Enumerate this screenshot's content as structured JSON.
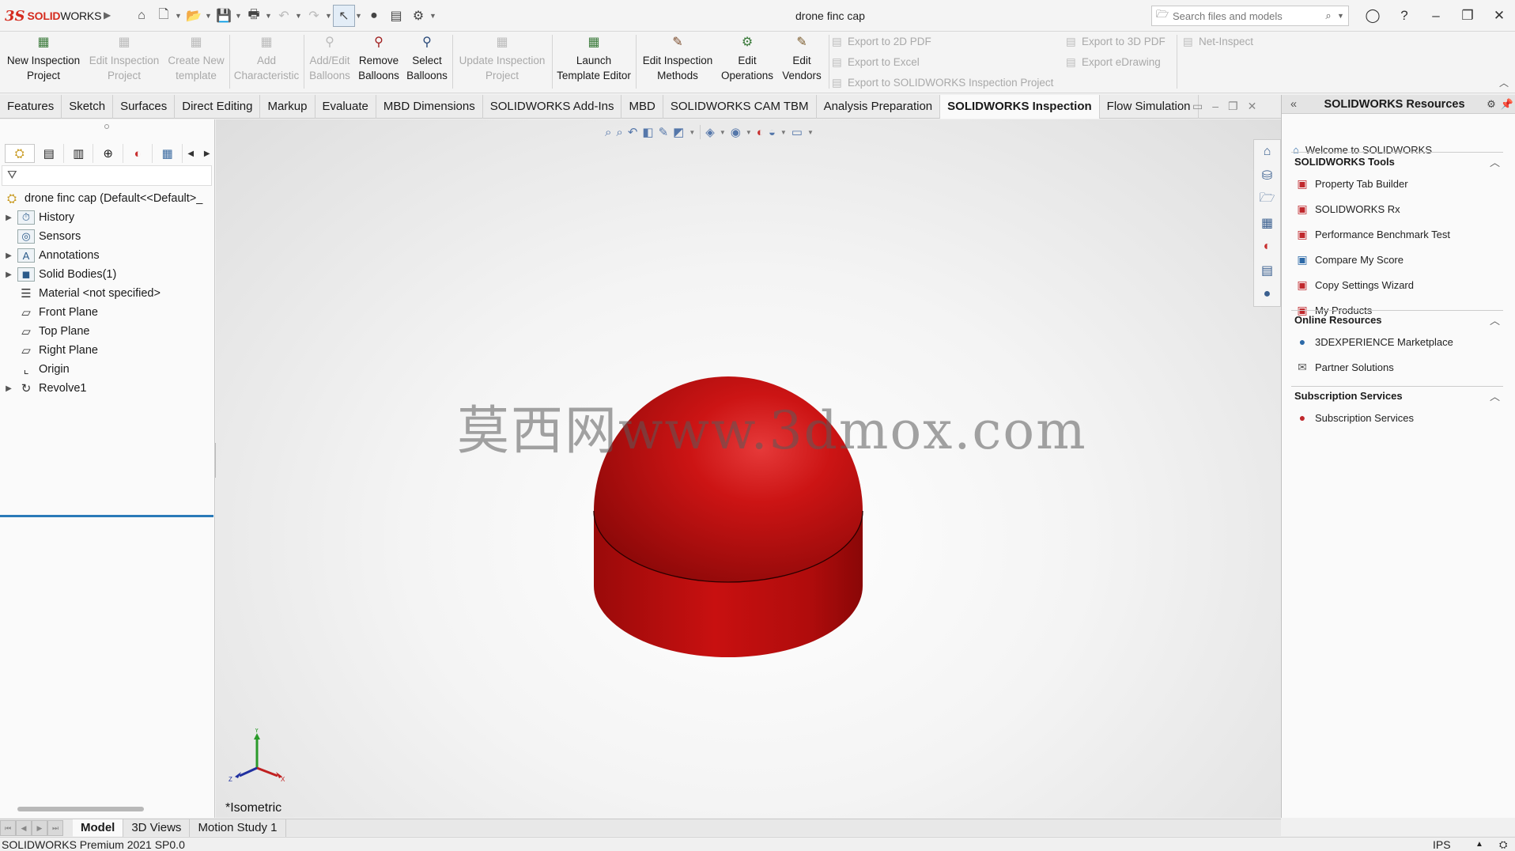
{
  "app": {
    "logo_ds": "3S",
    "logo_solid": "SOLID",
    "logo_works": "WORKS",
    "document_title": "drone finc cap",
    "search_placeholder": "Search files and models"
  },
  "ribbon": {
    "buttons": [
      {
        "label": "New Inspection Project",
        "enabled": true,
        "icon": "new-inspection-icon"
      },
      {
        "label": "Edit Inspection Project",
        "enabled": false,
        "icon": "edit-inspection-icon"
      },
      {
        "label": "Create New template",
        "enabled": false,
        "icon": "create-template-icon"
      },
      {
        "label": "Add Characteristic",
        "enabled": false,
        "icon": "add-characteristic-icon"
      },
      {
        "label": "Add/Edit Balloons",
        "enabled": false,
        "icon": "add-balloons-icon"
      },
      {
        "label": "Remove Balloons",
        "enabled": true,
        "icon": "remove-balloons-icon"
      },
      {
        "label": "Select Balloons",
        "enabled": true,
        "icon": "select-balloons-icon"
      },
      {
        "label": "Update Inspection Project",
        "enabled": false,
        "icon": "update-inspection-icon"
      },
      {
        "label": "Launch Template Editor",
        "enabled": true,
        "icon": "template-editor-icon"
      },
      {
        "label": "Edit Inspection Methods",
        "enabled": true,
        "icon": "inspection-methods-icon"
      },
      {
        "label": "Edit Operations",
        "enabled": true,
        "icon": "edit-operations-icon"
      },
      {
        "label": "Edit Vendors",
        "enabled": true,
        "icon": "edit-vendors-icon"
      }
    ],
    "export_list_1": [
      "Export to 2D PDF",
      "Export to Excel",
      "Export to SOLIDWORKS Inspection Project"
    ],
    "export_list_2": [
      "Export to 3D PDF",
      "Export eDrawing"
    ],
    "net_inspect": "Net-Inspect"
  },
  "tabs": [
    {
      "label": "Features",
      "active": false
    },
    {
      "label": "Sketch",
      "active": false
    },
    {
      "label": "Surfaces",
      "active": false
    },
    {
      "label": "Direct Editing",
      "active": false
    },
    {
      "label": "Markup",
      "active": false
    },
    {
      "label": "Evaluate",
      "active": false
    },
    {
      "label": "MBD Dimensions",
      "active": false
    },
    {
      "label": "SOLIDWORKS Add-Ins",
      "active": false
    },
    {
      "label": "MBD",
      "active": false
    },
    {
      "label": "SOLIDWORKS CAM TBM",
      "active": false
    },
    {
      "label": "Analysis Preparation",
      "active": false
    },
    {
      "label": "SOLIDWORKS Inspection",
      "active": true
    },
    {
      "label": "Flow Simulation",
      "active": false
    }
  ],
  "feature_tree": {
    "root": "drone finc cap  (Default<<Default>_",
    "items": [
      {
        "label": "History",
        "expandable": true,
        "icon": "history-folder-icon"
      },
      {
        "label": "Sensors",
        "expandable": false,
        "icon": "sensors-folder-icon"
      },
      {
        "label": "Annotations",
        "expandable": true,
        "icon": "annotations-folder-icon"
      },
      {
        "label": "Solid Bodies(1)",
        "expandable": true,
        "icon": "solid-bodies-folder-icon"
      },
      {
        "label": "Material <not specified>",
        "expandable": false,
        "icon": "material-icon"
      },
      {
        "label": "Front Plane",
        "expandable": false,
        "icon": "plane-icon"
      },
      {
        "label": "Top Plane",
        "expandable": false,
        "icon": "plane-icon"
      },
      {
        "label": "Right Plane",
        "expandable": false,
        "icon": "plane-icon"
      },
      {
        "label": "Origin",
        "expandable": false,
        "icon": "origin-icon"
      },
      {
        "label": "Revolve1",
        "expandable": true,
        "icon": "revolve-icon"
      }
    ]
  },
  "viewport": {
    "watermark": "莫西网www.3dmox.com",
    "view_label": "*Isometric",
    "model_color": "#c41010",
    "triad_labels": {
      "x": "X",
      "y": "Y",
      "z": "Z"
    }
  },
  "task_pane": {
    "title": "SOLIDWORKS Resources",
    "welcome": "Welcome to SOLIDWORKS",
    "sections": [
      {
        "title": "SOLIDWORKS Tools",
        "items": [
          "Property Tab Builder",
          "SOLIDWORKS Rx",
          "Performance Benchmark Test",
          "Compare My Score",
          "Copy Settings Wizard",
          "My Products"
        ]
      },
      {
        "title": "Online Resources",
        "items": [
          "3DEXPERIENCE Marketplace",
          "Partner Solutions"
        ]
      },
      {
        "title": "Subscription Services",
        "items": [
          "Subscription Services"
        ]
      }
    ]
  },
  "bottom_tabs": [
    {
      "label": "Model",
      "active": true
    },
    {
      "label": "3D Views",
      "active": false
    },
    {
      "label": "Motion Study 1",
      "active": false
    }
  ],
  "status": {
    "product": "SOLIDWORKS Premium 2021 SP0.0",
    "units": "IPS"
  }
}
